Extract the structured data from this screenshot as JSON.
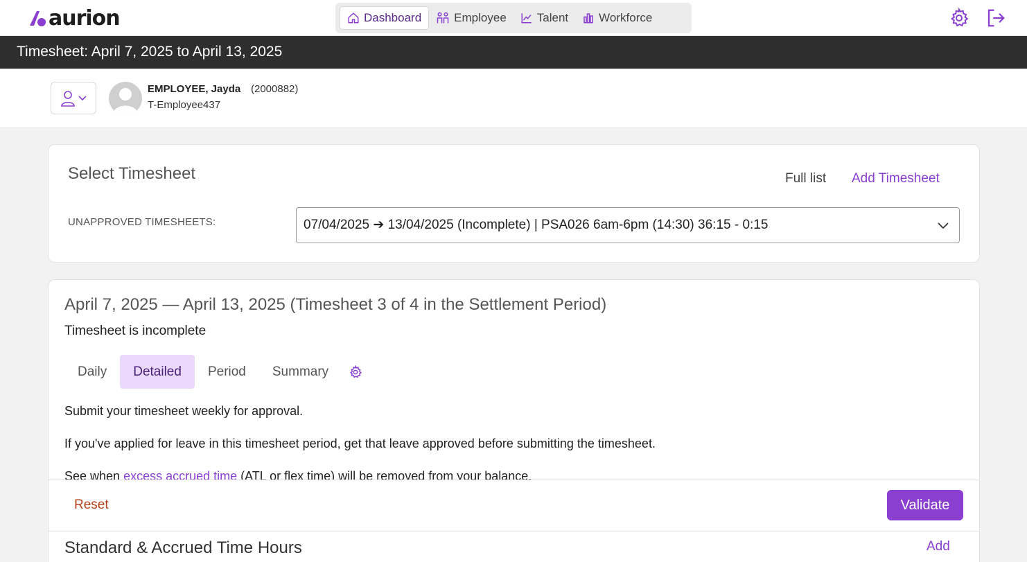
{
  "app": {
    "logo_text": "aurion"
  },
  "nav": {
    "items": [
      {
        "label": "Dashboard",
        "icon": "home-icon",
        "active": true
      },
      {
        "label": "Employee",
        "icon": "people-icon",
        "active": false
      },
      {
        "label": "Talent",
        "icon": "trend-chart-icon",
        "active": false
      },
      {
        "label": "Workforce",
        "icon": "bar-chart-icon",
        "active": false
      }
    ],
    "settings_icon": "gear-icon",
    "logout_icon": "logout-icon"
  },
  "titlebar": {
    "title": "Timesheet: April 7, 2025 to April 13, 2025"
  },
  "employee": {
    "name": "EMPLOYEE, Jayda",
    "id": "(2000882)",
    "code": "T-Employee437"
  },
  "select_timesheet": {
    "title": "Select Timesheet",
    "full_list": "Full list",
    "add_timesheet": "Add Timesheet",
    "unapproved_label": "UNAPPROVED TIMESHEETS:",
    "selected_value": "07/04/2025 ➔ 13/04/2025 (Incomplete) | PSA026 6am-6pm (14:30) 36:15 - 0:15"
  },
  "timesheet": {
    "period_title": "April 7, 2025 — April 13, 2025 (Timesheet 3 of 4 in the Settlement Period)",
    "status": "Timesheet is incomplete",
    "tabs": [
      "Daily",
      "Detailed",
      "Period",
      "Summary"
    ],
    "active_tab": "Detailed",
    "info_1": "Submit your timesheet weekly for approval.",
    "info_2": "If you've applied for leave in this timesheet period, get that leave approved before submitting the timesheet.",
    "info_3_prefix": "See when ",
    "info_3_link": "excess accrued time",
    "info_3_suffix": " (ATL or flex time) will be removed from your balance."
  },
  "actions": {
    "reset": "Reset",
    "validate": "Validate"
  },
  "hours": {
    "title": "Standard & Accrued Time Hours",
    "add": "Add"
  },
  "colors": {
    "accent": "#8a3fd1",
    "titlebar": "#2e2e2e",
    "reset": "#b3421a",
    "active_tab_bg": "#ead9fa"
  }
}
